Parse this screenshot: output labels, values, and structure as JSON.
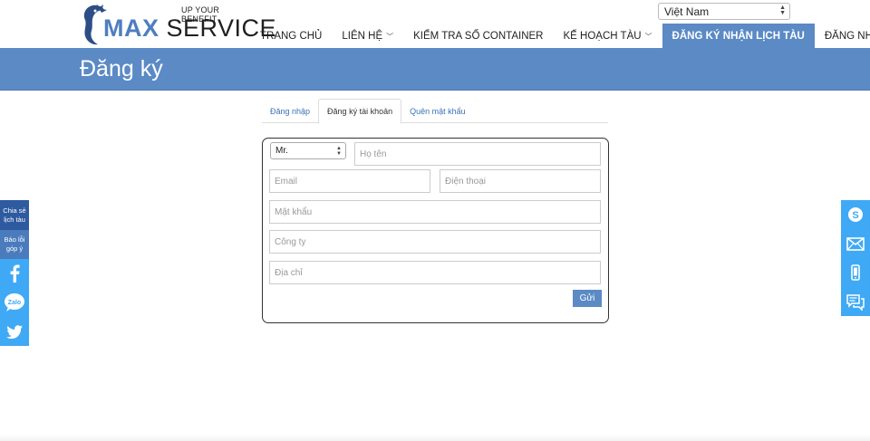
{
  "header": {
    "logo_tagline": "UP YOUR BENEFIT",
    "logo_max": "MAX",
    "logo_service": "SERVICE",
    "language": "Việt Nam"
  },
  "nav": {
    "items": [
      {
        "label": "TRANG CHỦ"
      },
      {
        "label": "LIÊN HỆ"
      },
      {
        "label": "KIỂM TRA SỐ CONTAINER"
      },
      {
        "label": "KẾ HOẠCH TÀU"
      },
      {
        "label": "ĐĂNG KÝ NHẬN LỊCH TÀU"
      },
      {
        "label": "ĐĂNG NHẬP"
      }
    ]
  },
  "banner": {
    "title": "Đăng ký"
  },
  "tabs": [
    {
      "label": "Đăng nhập"
    },
    {
      "label": "Đăng ký tài khoản"
    },
    {
      "label": "Quên mật khẩu"
    }
  ],
  "form": {
    "salutation": "Mr.",
    "name_placeholder": "Họ tên",
    "email_placeholder": "Email",
    "phone_placeholder": "Điện thoại",
    "password_placeholder": "Mật khẩu",
    "company_placeholder": "Công ty",
    "address_placeholder": "Địa chỉ",
    "submit_label": "Gửi"
  },
  "share_bar": {
    "share_schedule": "Chia sẻ lịch tàu",
    "report_error": "Báo lỗi góp ý"
  },
  "colors": {
    "brand_blue": "#5b8ac5",
    "social_blue": "#3fa9f5"
  }
}
